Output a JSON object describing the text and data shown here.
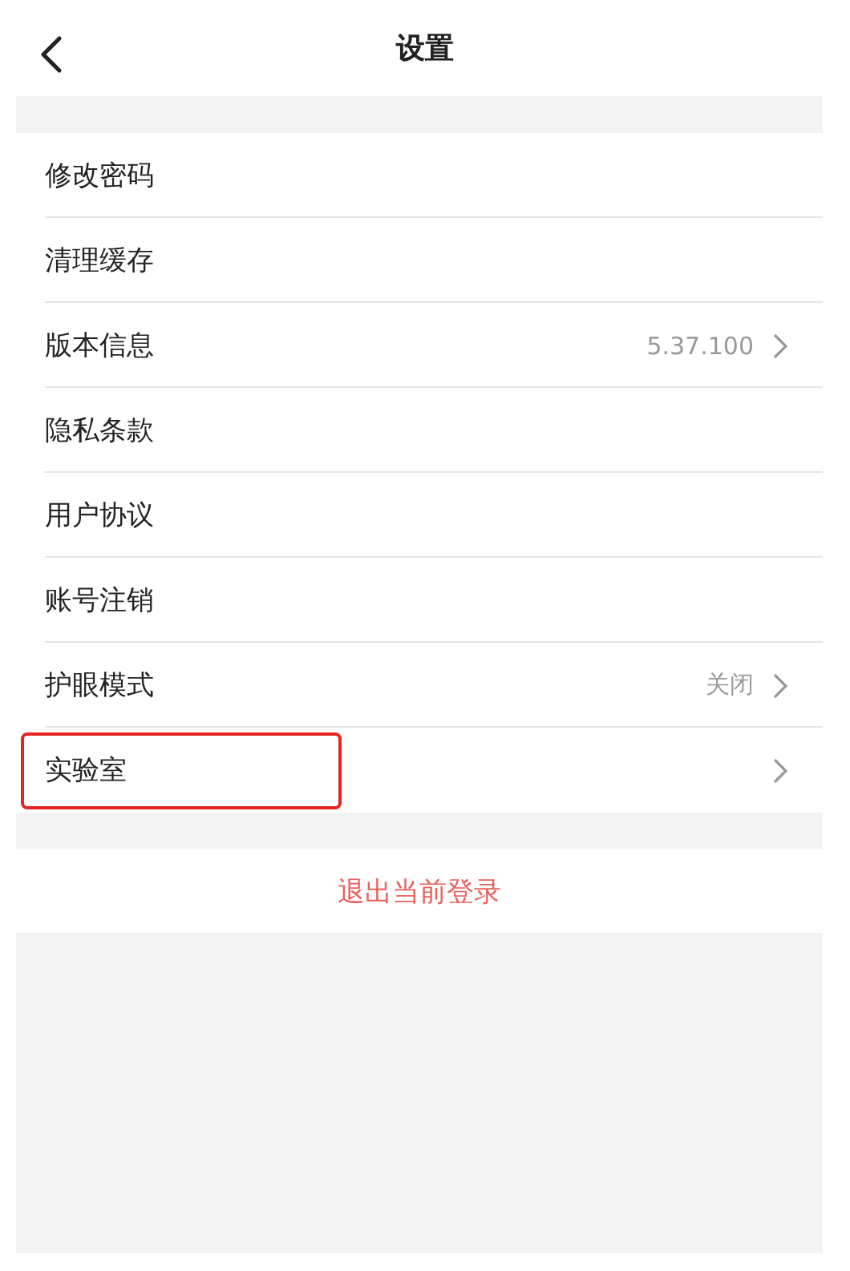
{
  "header": {
    "title": "设置"
  },
  "settings": [
    {
      "label": "修改密码",
      "chevron": false,
      "highlighted": false
    },
    {
      "label": "清理缓存",
      "chevron": false,
      "highlighted": false
    },
    {
      "label": "版本信息",
      "value": "5.37.100",
      "chevron": true,
      "highlighted": false
    },
    {
      "label": "隐私条款",
      "chevron": false,
      "highlighted": false
    },
    {
      "label": "用户协议",
      "chevron": false,
      "highlighted": false
    },
    {
      "label": "账号注销",
      "chevron": false,
      "highlighted": false
    },
    {
      "label": "护眼模式",
      "value": "关闭",
      "chevron": true,
      "highlighted": false
    },
    {
      "label": "实验室",
      "chevron": true,
      "highlighted": true
    }
  ],
  "logout": "退出当前登录"
}
